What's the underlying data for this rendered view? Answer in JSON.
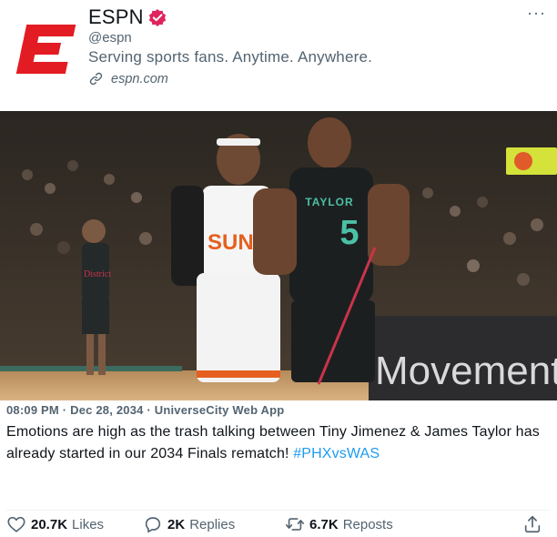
{
  "account": {
    "name": "ESPN",
    "handle": "@espn",
    "bio": "Serving sports fans. Anytime. Anywhere.",
    "website": "espn.com",
    "brand_color": "#e31b23",
    "verified_color": "#e0245e"
  },
  "media": {
    "player_left_jersey_name": "TAYLOR",
    "player_left_jersey_number": "5",
    "player_right_jersey_name": "SUNS",
    "background_player_jersey": "District",
    "court_ad": "Movement tha"
  },
  "tweet": {
    "meta": "08:09 PM · Dec 28, 2034 · UniverseCity Web App",
    "text": "Emotions are high as the trash talking between Tiny Jimenez & James Taylor has already started in our 2034 Finals rematch! ",
    "hashtag": "#PHXvsWAS"
  },
  "actions": {
    "likes_count": "20.7K",
    "likes_label": "Likes",
    "replies_count": "2K",
    "replies_label": "Replies",
    "reposts_count": "6.7K",
    "reposts_label": "Reposts"
  },
  "icons": {
    "more": "more-icon",
    "link": "link-icon",
    "heart": "heart-icon",
    "reply": "reply-icon",
    "repost": "repost-icon",
    "share": "share-icon"
  }
}
